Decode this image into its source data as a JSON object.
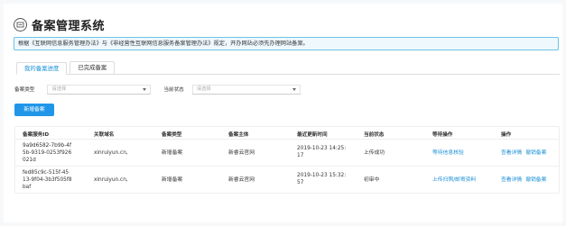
{
  "page": {
    "title": "备案管理系统",
    "logo_icon": "filing-logo-icon"
  },
  "notice": {
    "text": "根据《互联网信息服务管理办法》与《非经营性互联网信息服务备案管理办法》规定，开办网站必须先办理网站备案。"
  },
  "tabs": [
    {
      "label": "我的备案进度",
      "active": true
    },
    {
      "label": "已完成备案",
      "active": false
    }
  ],
  "filters": {
    "type_label": "备案类型",
    "type_placeholder": "请选择",
    "status_label": "当前状态",
    "status_placeholder": "请选择"
  },
  "actions": {
    "new_filing": "新增备案"
  },
  "table": {
    "headers": [
      "备案服务ID",
      "关联域名",
      "备案类型",
      "备案主体",
      "最近更新时间",
      "当前状态",
      "等待操作",
      "操作"
    ],
    "rows": [
      {
        "id_line1": "9a9d6582-7b9b-4f",
        "id_line2": "5b-9319-0253f926",
        "id_line3": "021d",
        "domain": "xinruiyun.cn,",
        "type": "新增备案",
        "subject": "新睿云官网",
        "time_line1": "2019-10-23 14:25:",
        "time_line2": "17",
        "status": "上传成功",
        "pending": "等待信息核验",
        "op1": "查看详情",
        "op2": "撤销备案"
      },
      {
        "id_line1": "fed85c9c-515f-45",
        "id_line2": "13-9f04-3b3f505f8",
        "id_line3": "baf",
        "domain": "xinruiyun.cn,",
        "type": "新增备案",
        "subject": "新睿云官网",
        "time_line1": "2019-10-23 15:32:",
        "time_line2": "57",
        "status": "初审中",
        "pending": "上传扫照/邮寄资料",
        "op1": "查看详情",
        "op2": "撤销备案"
      }
    ]
  },
  "colors": {
    "accent": "#1a8fd6",
    "button": "#2196e8",
    "notice_border": "#6cc3e8"
  }
}
